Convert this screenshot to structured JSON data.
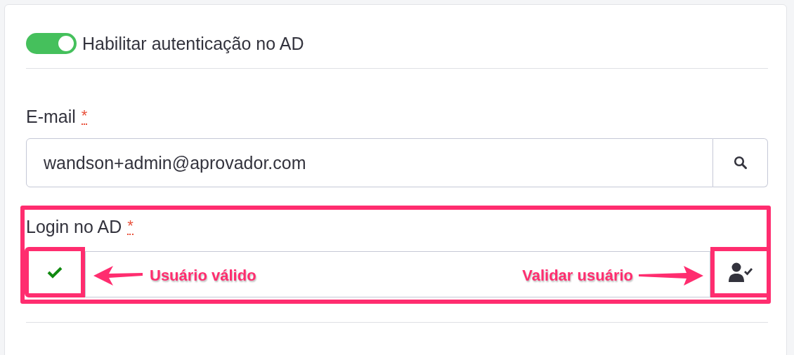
{
  "toggle": {
    "label": "Habilitar autenticação no AD",
    "on": true
  },
  "email": {
    "label": "E-mail",
    "required_mark": "*",
    "value": "wandson+admin@aprovador.com"
  },
  "login": {
    "label": "Login no AD",
    "required_mark": "*",
    "valid": true
  },
  "annotations": [
    {
      "text": "Usuário válido"
    },
    {
      "text": "Validar usuário"
    }
  ]
}
